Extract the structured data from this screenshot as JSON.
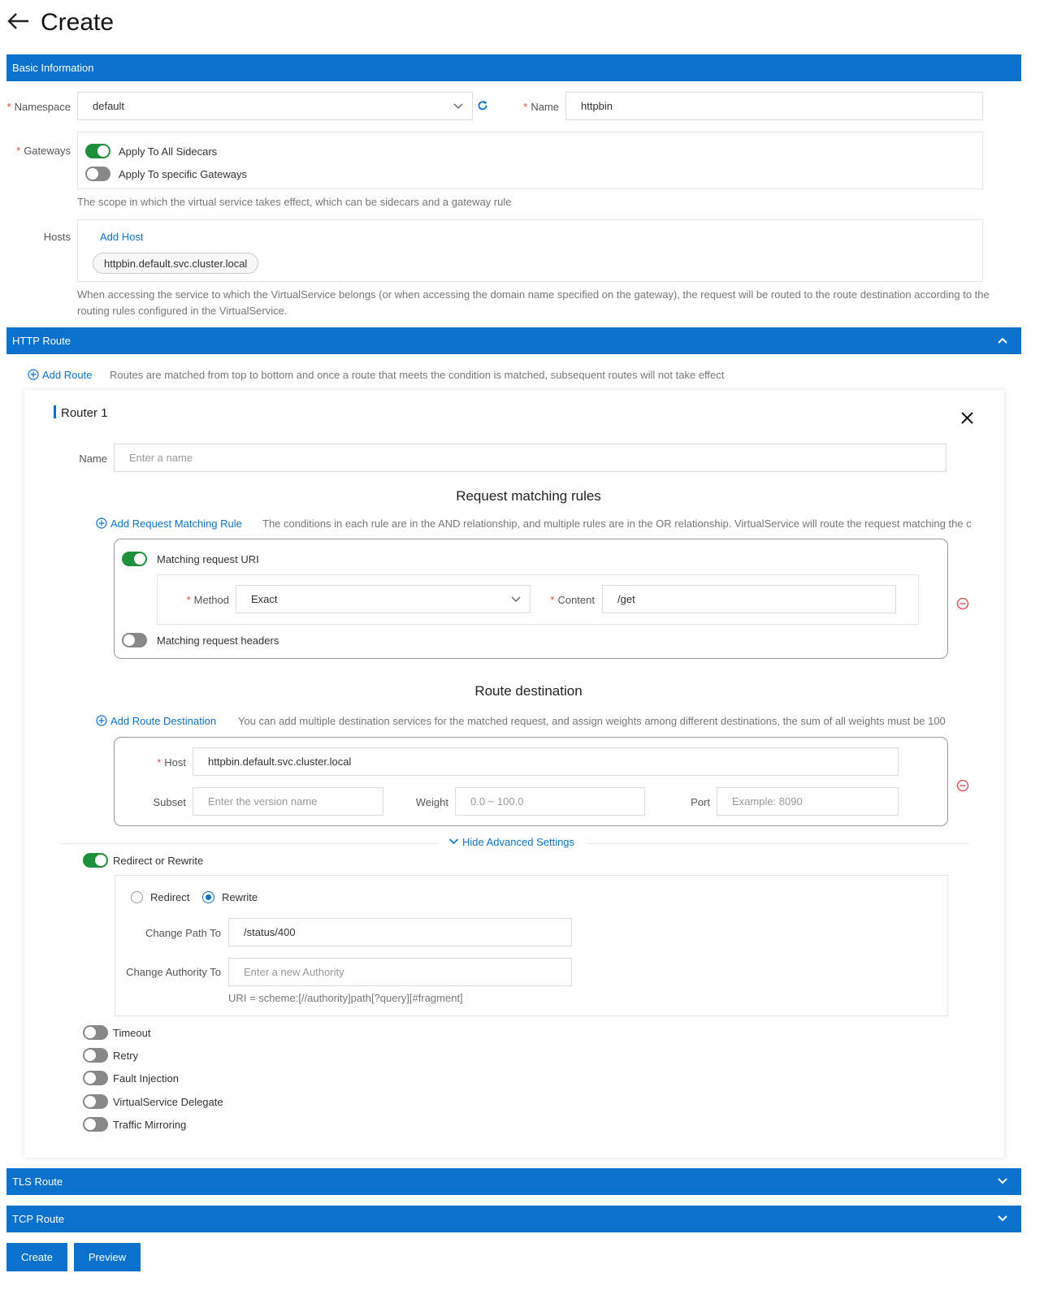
{
  "page": {
    "title": "Create",
    "back_icon": "arrow-left-icon"
  },
  "basic": {
    "section_label": "Basic Information",
    "namespace_label": "Namespace",
    "namespace_value": "default",
    "name_label": "Name",
    "name_value": "httpbin",
    "gateways_label": "Gateways",
    "gateway_options": [
      {
        "label": "Apply To All Sidecars",
        "on": true
      },
      {
        "label": "Apply To specific Gateways",
        "on": false
      }
    ],
    "gateways_help": "The scope in which the virtual service takes effect, which can be sidecars and a gateway rule",
    "hosts_label": "Hosts",
    "add_host_label": "Add Host",
    "hosts": [
      "httpbin.default.svc.cluster.local"
    ],
    "hosts_help": "When accessing the service to which the VirtualService belongs (or when accessing the domain name specified on the gateway), the request will be routed to the route destination according to the routing rules configured in the VirtualService."
  },
  "http_route": {
    "section_label": "HTTP Route",
    "add_route_label": "Add Route",
    "add_route_help": "Routes are matched from top to bottom and once a route that meets the condition is matched, subsequent routes will not take effect",
    "router": {
      "title": "Router 1",
      "name_label": "Name",
      "name_placeholder": "Enter a name",
      "matching": {
        "heading": "Request matching rules",
        "add_label": "Add Request Matching Rule",
        "help": "The conditions in each rule are in the AND relationship, and multiple rules are in the OR relationship. VirtualService will route the request matching the c",
        "uri_toggle_label": "Matching request URI",
        "uri_toggle_on": true,
        "method_label": "Method",
        "method_value": "Exact",
        "content_label": "Content",
        "content_value": "/get",
        "headers_toggle_label": "Matching request headers",
        "headers_toggle_on": false
      },
      "destination": {
        "heading": "Route destination",
        "add_label": "Add Route Destination",
        "help": "You can add multiple destination services for the matched request, and assign weights among different destinations, the sum of all weights must be 100",
        "host_label": "Host",
        "host_value": "httpbin.default.svc.cluster.local",
        "subset_label": "Subset",
        "subset_placeholder": "Enter the version name",
        "weight_label": "Weight",
        "weight_placeholder": "0.0 ~ 100.0",
        "port_label": "Port",
        "port_placeholder": "Example: 8090"
      },
      "advanced_toggle_label": "Hide Advanced Settings",
      "redirect_rewrite": {
        "label": "Redirect or Rewrite",
        "on": true,
        "options": [
          {
            "label": "Redirect",
            "checked": false
          },
          {
            "label": "Rewrite",
            "checked": true
          }
        ],
        "path_label": "Change Path To",
        "path_value": "/status/400",
        "authority_label": "Change Authority To",
        "authority_placeholder": "Enter a new Authority",
        "uri_hint": "URI = scheme:[//authority]path[?query][#fragment]"
      },
      "toggles": [
        {
          "label": "Timeout",
          "on": false
        },
        {
          "label": "Retry",
          "on": false
        },
        {
          "label": "Fault Injection",
          "on": false
        },
        {
          "label": "VirtualService Delegate",
          "on": false
        },
        {
          "label": "Traffic Mirroring",
          "on": false
        }
      ]
    }
  },
  "tls_route": {
    "section_label": "TLS Route"
  },
  "tcp_route": {
    "section_label": "TCP Route"
  },
  "actions": {
    "create_label": "Create",
    "preview_label": "Preview"
  },
  "colors": {
    "primary": "#0a72cc",
    "switch_on": "#1e8f3a",
    "switch_off": "#888888",
    "required": "#e54545",
    "remove": "#e54545"
  }
}
